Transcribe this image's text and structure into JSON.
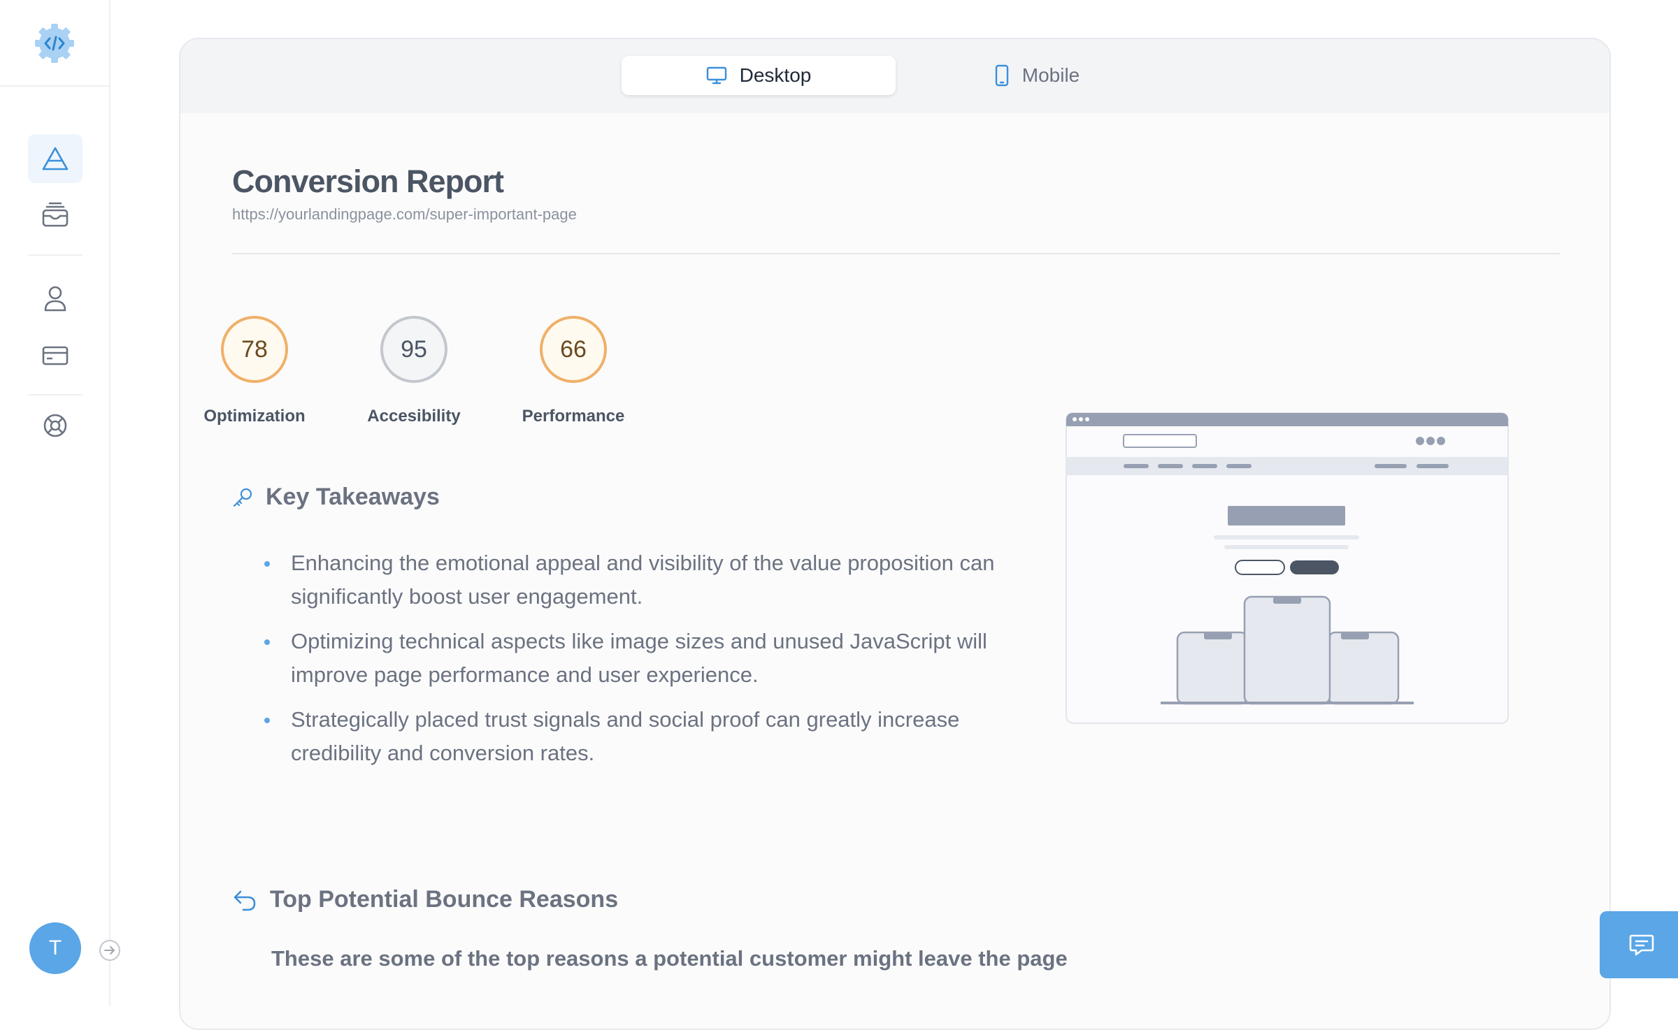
{
  "sidebar": {
    "avatar_initial": "T"
  },
  "tabs": [
    {
      "label": "Desktop",
      "icon": "monitor-icon",
      "active": true
    },
    {
      "label": "Mobile",
      "icon": "smartphone-icon",
      "active": false
    }
  ],
  "report": {
    "title": "Conversion Report",
    "url": "https://yourlandingpage.com/super-important-page"
  },
  "scores": [
    {
      "value": "78",
      "label": "Optimization",
      "status": "warning"
    },
    {
      "value": "95",
      "label": "Accesibility",
      "status": "neutral"
    },
    {
      "value": "66",
      "label": "Performance",
      "status": "warning"
    }
  ],
  "key_takeaways": {
    "heading": "Key Takeaways",
    "items": [
      "Enhancing the emotional appeal and visibility of the value proposition can significantly boost user engagement.",
      "Optimizing technical aspects like image sizes and unused JavaScript will improve page performance and user experience.",
      "Strategically placed trust signals and social proof can greatly increase credibility and conversion rates."
    ]
  },
  "bounce": {
    "heading": "Top Potential Bounce Reasons",
    "subtitle": "These are some of the top reasons a potential customer might leave the page"
  },
  "colors": {
    "accent": "#5aa6e6",
    "warning_ring": "#f0b069",
    "neutral_ring": "#c3c7cd"
  }
}
